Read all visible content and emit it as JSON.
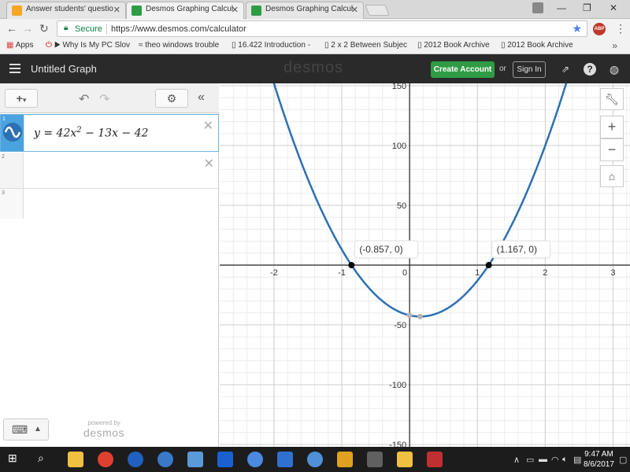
{
  "browser": {
    "tabs": [
      {
        "title": "Answer students' questio",
        "active": false,
        "favicon_color": "#f5a623"
      },
      {
        "title": "Desmos Graphing Calcul",
        "active": true,
        "favicon_color": "#2f9c45"
      },
      {
        "title": "Desmos Graphing Calcul",
        "active": false,
        "favicon_color": "#2f9c45"
      }
    ],
    "window_controls": {
      "minimize": "—",
      "restore": "❐",
      "close": "✕"
    },
    "secure_label": "Secure",
    "url": "https://www.desmos.com/calculator",
    "abp_label": "ABP",
    "bookmarks": [
      "Apps",
      "Why Is My PC Slov",
      "theo windows trouble",
      "16.422 Introduction -",
      "2 x 2 Between Subjec",
      "2012 Book Archive",
      "2012 Book Archive"
    ]
  },
  "desmos": {
    "graph_title": "Untitled Graph",
    "logo": "desmos",
    "create_account": "Create Account",
    "or": "or",
    "sign_in": "Sign In",
    "expressions": [
      {
        "number": "1",
        "lhs": "y",
        "text": " = 42x",
        "sup": "2",
        "rest": " − 13x − 42",
        "color": "#2d70b3"
      },
      {
        "number": "2",
        "text": ""
      },
      {
        "number": "3",
        "text": ""
      }
    ],
    "powered_by": "powered by",
    "powered_logo": "desmos"
  },
  "chart_data": {
    "type": "line",
    "equation": "y = 42x^2 - 13x - 42",
    "curve_color": "#2d70b3",
    "xlim": [
      -2.8,
      3.25
    ],
    "ylim": [
      -152,
      152
    ],
    "x_ticks": [
      -2,
      -1,
      0,
      1,
      2,
      3
    ],
    "y_ticks": [
      150,
      100,
      50,
      -50,
      -100,
      -150
    ],
    "grid": true,
    "points": [
      {
        "x": -0.857,
        "y": 0,
        "label": "(-0.857, 0)"
      },
      {
        "x": 1.167,
        "y": 0,
        "label": "(1.167, 0)"
      }
    ],
    "vertex_marks": [
      {
        "x": 0.0,
        "y": -42
      },
      {
        "x": 0.155,
        "y": -43
      }
    ]
  },
  "taskbar": {
    "time": "9:47 AM",
    "date": "8/6/2017"
  }
}
